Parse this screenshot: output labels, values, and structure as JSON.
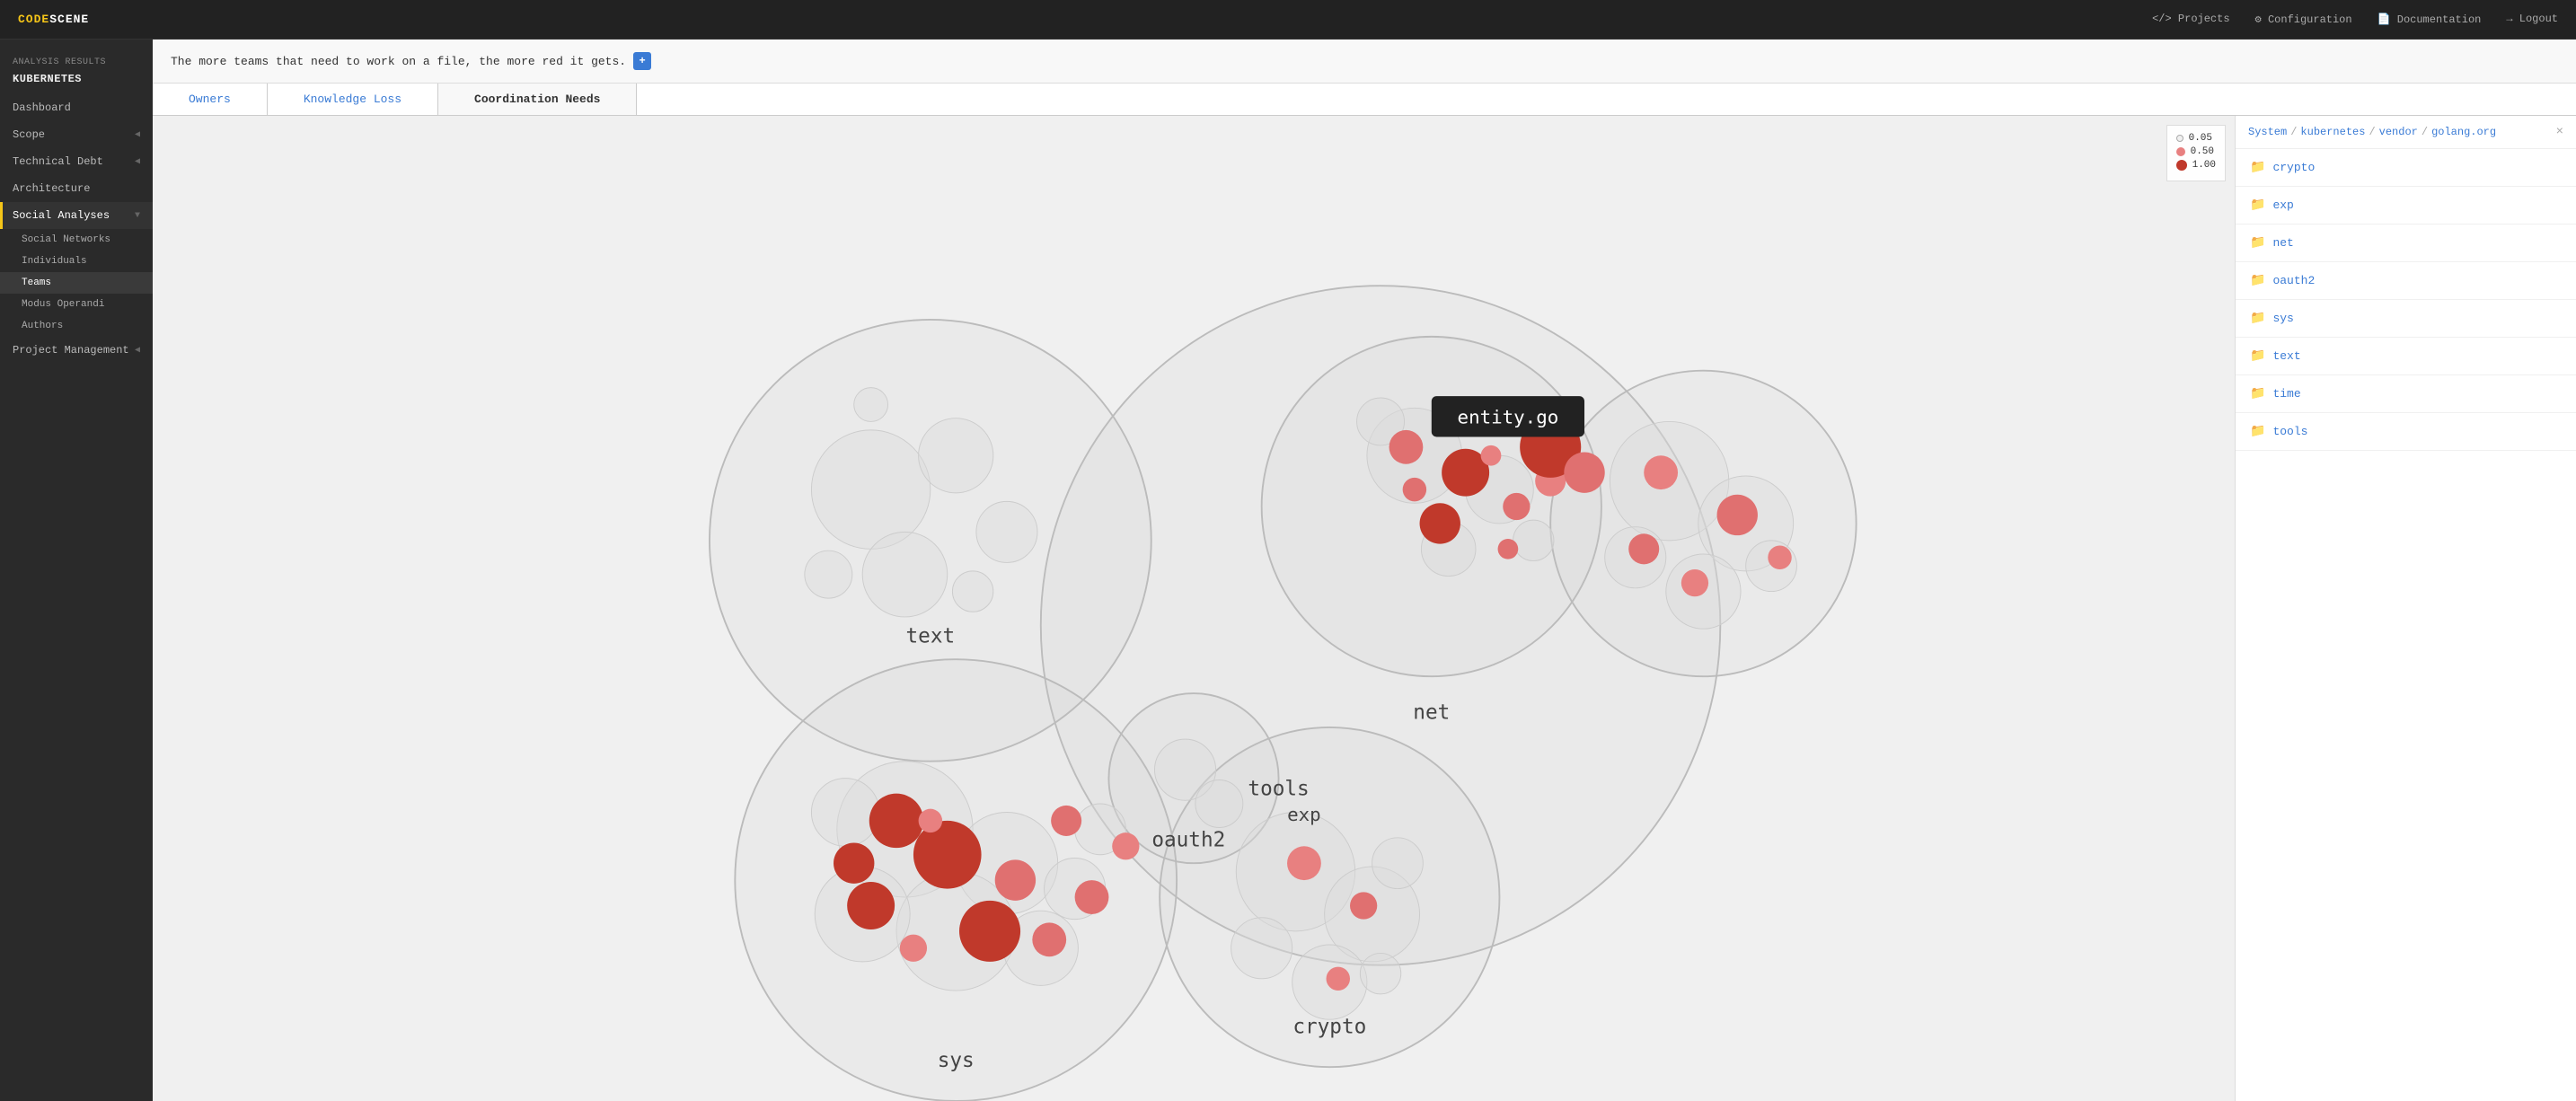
{
  "topnav": {
    "logo_prefix": "CODE",
    "logo_suffix": "SCENE",
    "links": [
      {
        "label": "Projects",
        "icon": "</>"
      },
      {
        "label": "Configuration",
        "icon": "⚙"
      },
      {
        "label": "Documentation",
        "icon": "📄"
      },
      {
        "label": "Logout",
        "icon": "→"
      }
    ]
  },
  "sidebar": {
    "section_title": "ANALYSIS RESULTS",
    "project_name": "KUBERNETES",
    "items": [
      {
        "label": "Dashboard",
        "sub": false,
        "active": false
      },
      {
        "label": "Scope",
        "sub": false,
        "active": false,
        "arrow": true
      },
      {
        "label": "Technical Debt",
        "sub": false,
        "active": false,
        "arrow": true
      },
      {
        "label": "Architecture",
        "sub": false,
        "active": false
      },
      {
        "label": "Social Analyses",
        "sub": false,
        "active": true,
        "arrow": true
      },
      {
        "label": "Social Networks",
        "sub": true,
        "active": false
      },
      {
        "label": "Individuals",
        "sub": true,
        "active": false
      },
      {
        "label": "Teams",
        "sub": true,
        "active": true
      },
      {
        "label": "Modus Operandi",
        "sub": true,
        "active": false
      },
      {
        "label": "Authors",
        "sub": true,
        "active": false
      },
      {
        "label": "Project Management",
        "sub": false,
        "active": false,
        "arrow": true
      }
    ]
  },
  "header": {
    "text": "The more teams that need to work on a file, the more red it gets.",
    "info_label": "+"
  },
  "tabs": [
    {
      "label": "Owners",
      "active": false
    },
    {
      "label": "Knowledge Loss",
      "active": false
    },
    {
      "label": "Coordination Needs",
      "active": true
    }
  ],
  "legend": {
    "items": [
      {
        "value": "0.05",
        "color": "#f0f0f0",
        "size": 6
      },
      {
        "value": "0.50",
        "color": "#e88080",
        "size": 8
      },
      {
        "value": "1.00",
        "color": "#c0392b",
        "size": 10
      }
    ]
  },
  "breadcrumb": {
    "parts": [
      "System",
      "kubernetes",
      "vendor",
      "golang.org"
    ],
    "close": "×"
  },
  "folders": [
    {
      "name": "crypto"
    },
    {
      "name": "exp"
    },
    {
      "name": "net"
    },
    {
      "name": "oauth2"
    },
    {
      "name": "sys"
    },
    {
      "name": "text"
    },
    {
      "name": "time"
    },
    {
      "name": "tools"
    }
  ],
  "tooltip": {
    "label": "entity.go"
  },
  "bubble_labels": [
    {
      "text": "text",
      "x": "34%",
      "y": "34%"
    },
    {
      "text": "net",
      "x": "54%",
      "y": "42%"
    },
    {
      "text": "oauth2",
      "x": "44%",
      "y": "54%"
    },
    {
      "text": "tools",
      "x": "50%",
      "y": "52%"
    },
    {
      "text": "exp",
      "x": "52%",
      "y": "56%"
    },
    {
      "text": "crypto",
      "x": "50%",
      "y": "72%"
    },
    {
      "text": "sys",
      "x": "33%",
      "y": "72%"
    }
  ]
}
